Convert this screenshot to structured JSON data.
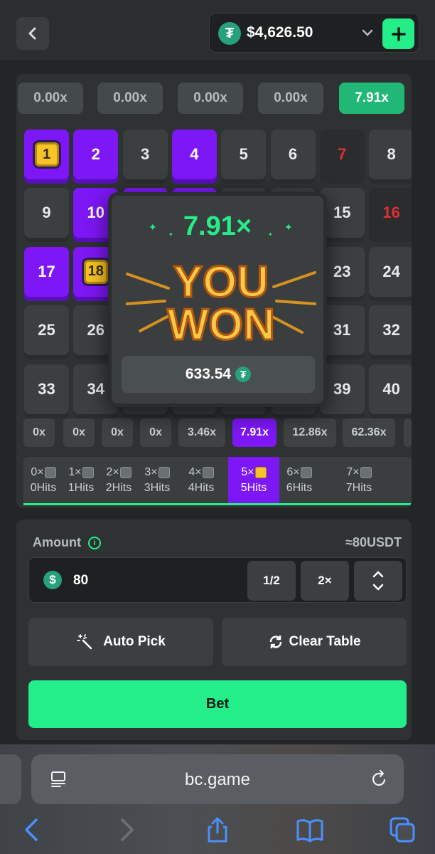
{
  "header": {
    "balance": "$4,626.50",
    "currency_glyph": "₮",
    "add_label": "+"
  },
  "history": [
    "0.00x",
    "0.00x",
    "0.00x",
    "0.00x",
    "7.91x"
  ],
  "board": {
    "picked_numbers": [
      1,
      2,
      4,
      10,
      11,
      12,
      17,
      18
    ],
    "hit_numbers": [
      1,
      18
    ],
    "drawn_numbers": [
      7,
      16
    ]
  },
  "multipliers": [
    "0x",
    "0x",
    "0x",
    "0x",
    "3.46x",
    "7.91x",
    "12.86x",
    "62.36x"
  ],
  "active_multiplier_index": 5,
  "hits": [
    {
      "top": "0×",
      "bottom": "0Hits"
    },
    {
      "top": "1×",
      "bottom": "1Hits"
    },
    {
      "top": "2×",
      "bottom": "2Hits"
    },
    {
      "top": "3×",
      "bottom": "3Hits"
    },
    {
      "top": "4×",
      "bottom": "4Hits"
    },
    {
      "top": "5×",
      "bottom": "5Hits"
    },
    {
      "top": "6×",
      "bottom": "6Hits"
    },
    {
      "top": "7×",
      "bottom": "7Hits"
    }
  ],
  "active_hit_index": 5,
  "win_popup": {
    "multiplier": "7.91×",
    "title_line1": "YOU",
    "title_line2": "WON",
    "amount": "633.54"
  },
  "controls": {
    "amount_label": "Amount",
    "amount_usdt": "≈80USDT",
    "amount_value": "80",
    "half_label": "1/2",
    "double_label": "2×",
    "auto_pick_label": "Auto Pick",
    "clear_table_label": "Clear Table",
    "bet_label": "Bet"
  },
  "browser": {
    "url": "bc.game"
  },
  "colors": {
    "accent_green": "#24ee89",
    "picked_purple": "#7d17f5",
    "drawn_red": "#e03131",
    "gold": "#f5c428"
  }
}
